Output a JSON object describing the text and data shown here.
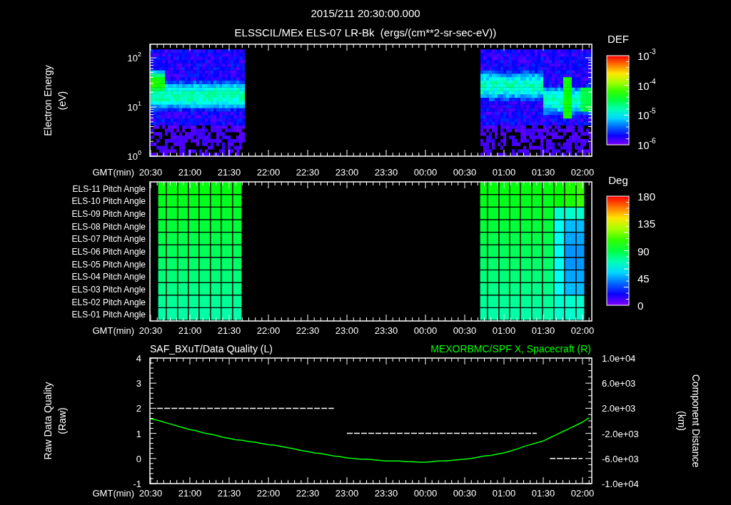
{
  "title": {
    "timestamp": "2015/211 20:30:00.000",
    "subtitle": "ELSSCIL/MEx ELS-07 LR-Bk  (ergs/(cm**2-sr-sec-eV))"
  },
  "energy_panel": {
    "ylabel": "Electron Energy",
    "yunit": "(eV)",
    "yticks": [
      {
        "base": "10",
        "exp": "2"
      },
      {
        "base": "10",
        "exp": "1"
      },
      {
        "base": "10",
        "exp": "0"
      }
    ],
    "time_label": "GMT(min)",
    "time_ticks": [
      "20:30",
      "21:00",
      "21:30",
      "22:00",
      "22:30",
      "23:00",
      "23:30",
      "00:00",
      "00:30",
      "01:00",
      "01:30",
      "02:00"
    ],
    "colorbar": {
      "title": "DEF",
      "ticks": [
        {
          "base": "10",
          "exp": "-3"
        },
        {
          "base": "10",
          "exp": "-4"
        },
        {
          "base": "10",
          "exp": "-5"
        },
        {
          "base": "10",
          "exp": "-6"
        }
      ]
    }
  },
  "pitch_panel": {
    "rows": [
      "ELS-11 Pitch Angle",
      "ELS-10 Pitch Angle",
      "ELS-09 Pitch Angle",
      "ELS-08 Pitch Angle",
      "ELS-07 Pitch Angle",
      "ELS-06 Pitch Angle",
      "ELS-05 Pitch Angle",
      "ELS-04 Pitch Angle",
      "ELS-03 Pitch Angle",
      "ELS-02 Pitch Angle",
      "ELS-01 Pitch Angle"
    ],
    "time_label": "GMT(min)",
    "time_ticks": [
      "20:30",
      "21:00",
      "21:30",
      "22:00",
      "22:30",
      "23:00",
      "23:30",
      "00:00",
      "00:30",
      "01:00",
      "01:30",
      "02:00"
    ],
    "colorbar": {
      "title": "Deg",
      "ticks": [
        "180",
        "135",
        "90",
        "45",
        "0"
      ]
    }
  },
  "quality_panel": {
    "ylabel": "Raw Data Quality",
    "yunit": "(Raw)",
    "y2label": "Component Distance",
    "y2unit": "(km)",
    "chart_data": {
      "type": "line",
      "xlabel": "GMT(min)",
      "categories": [
        "20:30",
        null,
        null,
        null,
        null,
        null,
        "21:00",
        null,
        null,
        null,
        null,
        null,
        "21:30",
        null,
        null,
        null,
        null,
        null,
        "22:00",
        null,
        null,
        null,
        null,
        null,
        "22:30",
        null,
        null,
        null,
        null,
        null,
        "23:00",
        null,
        null,
        null,
        null,
        null,
        "23:30",
        null,
        null,
        null,
        null,
        null,
        "00:00",
        null,
        null,
        null,
        null,
        null,
        "00:30",
        null,
        null,
        null,
        null,
        null,
        "01:00",
        null,
        null,
        null,
        null,
        null,
        "01:30",
        null,
        null,
        null,
        null,
        null,
        "02:00",
        null
      ],
      "ylim": [
        -1,
        4
      ],
      "yticks": [
        -1,
        0,
        1,
        2,
        3,
        4
      ],
      "y2lim": [
        -10000,
        10000
      ],
      "y2ticks": [
        {
          "value": 10000,
          "label": "1.0e+04"
        },
        {
          "value": 6000,
          "label": "6.0e+03"
        },
        {
          "value": 2000,
          "label": "2.0e+03"
        },
        {
          "value": -2000,
          "label": "-2.0e+03"
        },
        {
          "value": -6000,
          "label": "-6.0e+03"
        },
        {
          "value": -10000,
          "label": "-1.0e+04"
        }
      ],
      "series": [
        {
          "name": "SAF_BXuT/Data Quality (L)",
          "color": "#ffffff",
          "line_style": "dashed",
          "values": [
            null,
            2,
            2,
            2,
            2,
            2,
            2,
            2,
            2,
            2,
            2,
            2,
            2,
            2,
            2,
            2,
            2,
            2,
            2,
            2,
            2,
            2,
            2,
            2,
            2,
            2,
            2,
            2,
            2,
            null,
            1,
            1,
            1,
            1,
            1,
            1,
            1,
            1,
            1,
            1,
            1,
            1,
            1,
            1,
            1,
            1,
            1,
            1,
            1,
            1,
            1,
            1,
            1,
            1,
            1,
            1,
            1,
            1,
            1,
            1,
            null,
            0,
            0,
            0,
            0,
            0,
            0,
            null
          ]
        },
        {
          "name": "MEXORBMC/SPF X, Spacecraft (R)",
          "color": "#00ff00",
          "axis": "y2",
          "line_style": "solid",
          "values": [
            300,
            100,
            -200,
            -500,
            -800,
            -1100,
            -1400,
            -1600,
            -1900,
            -2100,
            -2300,
            -2600,
            -2800,
            -3000,
            -3100,
            -3300,
            -3400,
            -3600,
            -3800,
            -3900,
            -4100,
            -4300,
            -4500,
            -4700,
            -4900,
            -5100,
            -5200,
            -5400,
            -5600,
            -5700,
            -5900,
            -6000,
            -6100,
            -6100,
            -6200,
            -6300,
            -6400,
            -6400,
            -6400,
            -6500,
            -6500,
            -6600,
            -6600,
            -6500,
            -6400,
            -6400,
            -6300,
            -6200,
            -6100,
            -6000,
            -5800,
            -5600,
            -5500,
            -5300,
            -5100,
            -4800,
            -4500,
            -4100,
            -3800,
            -3500,
            -3200,
            -2700,
            -2200,
            -1700,
            -1200,
            -700,
            -200,
            500
          ]
        }
      ]
    }
  }
}
